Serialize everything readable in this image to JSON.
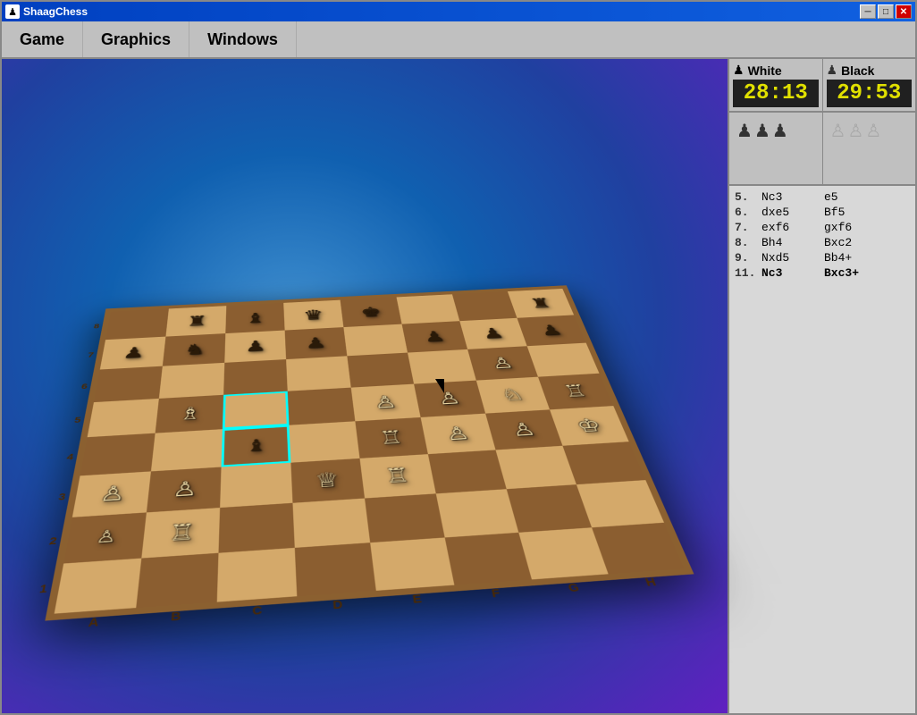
{
  "window": {
    "title": "ShaagChess",
    "titlebar_icon": "♟"
  },
  "titlebar_buttons": {
    "minimize": "─",
    "maximize": "□",
    "close": "✕"
  },
  "menu": {
    "items": [
      "Game",
      "Graphics",
      "Windows"
    ]
  },
  "clocks": {
    "white": {
      "label": "White",
      "icon": "♟",
      "time": "28:13"
    },
    "black": {
      "label": "Black",
      "icon": "♟",
      "time": "29:53"
    }
  },
  "captured": {
    "white_captured": [
      "♟",
      "♟",
      "♟"
    ],
    "black_captured": [
      "♙",
      "♙",
      "♙"
    ]
  },
  "moves": [
    {
      "num": "5.",
      "white": "Nc3",
      "black": "e5"
    },
    {
      "num": "6.",
      "white": "dxe5",
      "black": "Bf5"
    },
    {
      "num": "7.",
      "white": "exf6",
      "black": "gxf6"
    },
    {
      "num": "8.",
      "white": "Bh4",
      "black": "Bxc2"
    },
    {
      "num": "9.",
      "white": "Nxd5",
      "black": "Bb4+"
    },
    {
      "num": "11.",
      "white": "Nc3",
      "black": "Bxc3+"
    }
  ],
  "board": {
    "files": [
      "A",
      "B",
      "C",
      "D",
      "E",
      "F",
      "G",
      "H"
    ],
    "ranks": [
      "8",
      "7",
      "6",
      "5",
      "4",
      "3",
      "2",
      "1"
    ]
  }
}
